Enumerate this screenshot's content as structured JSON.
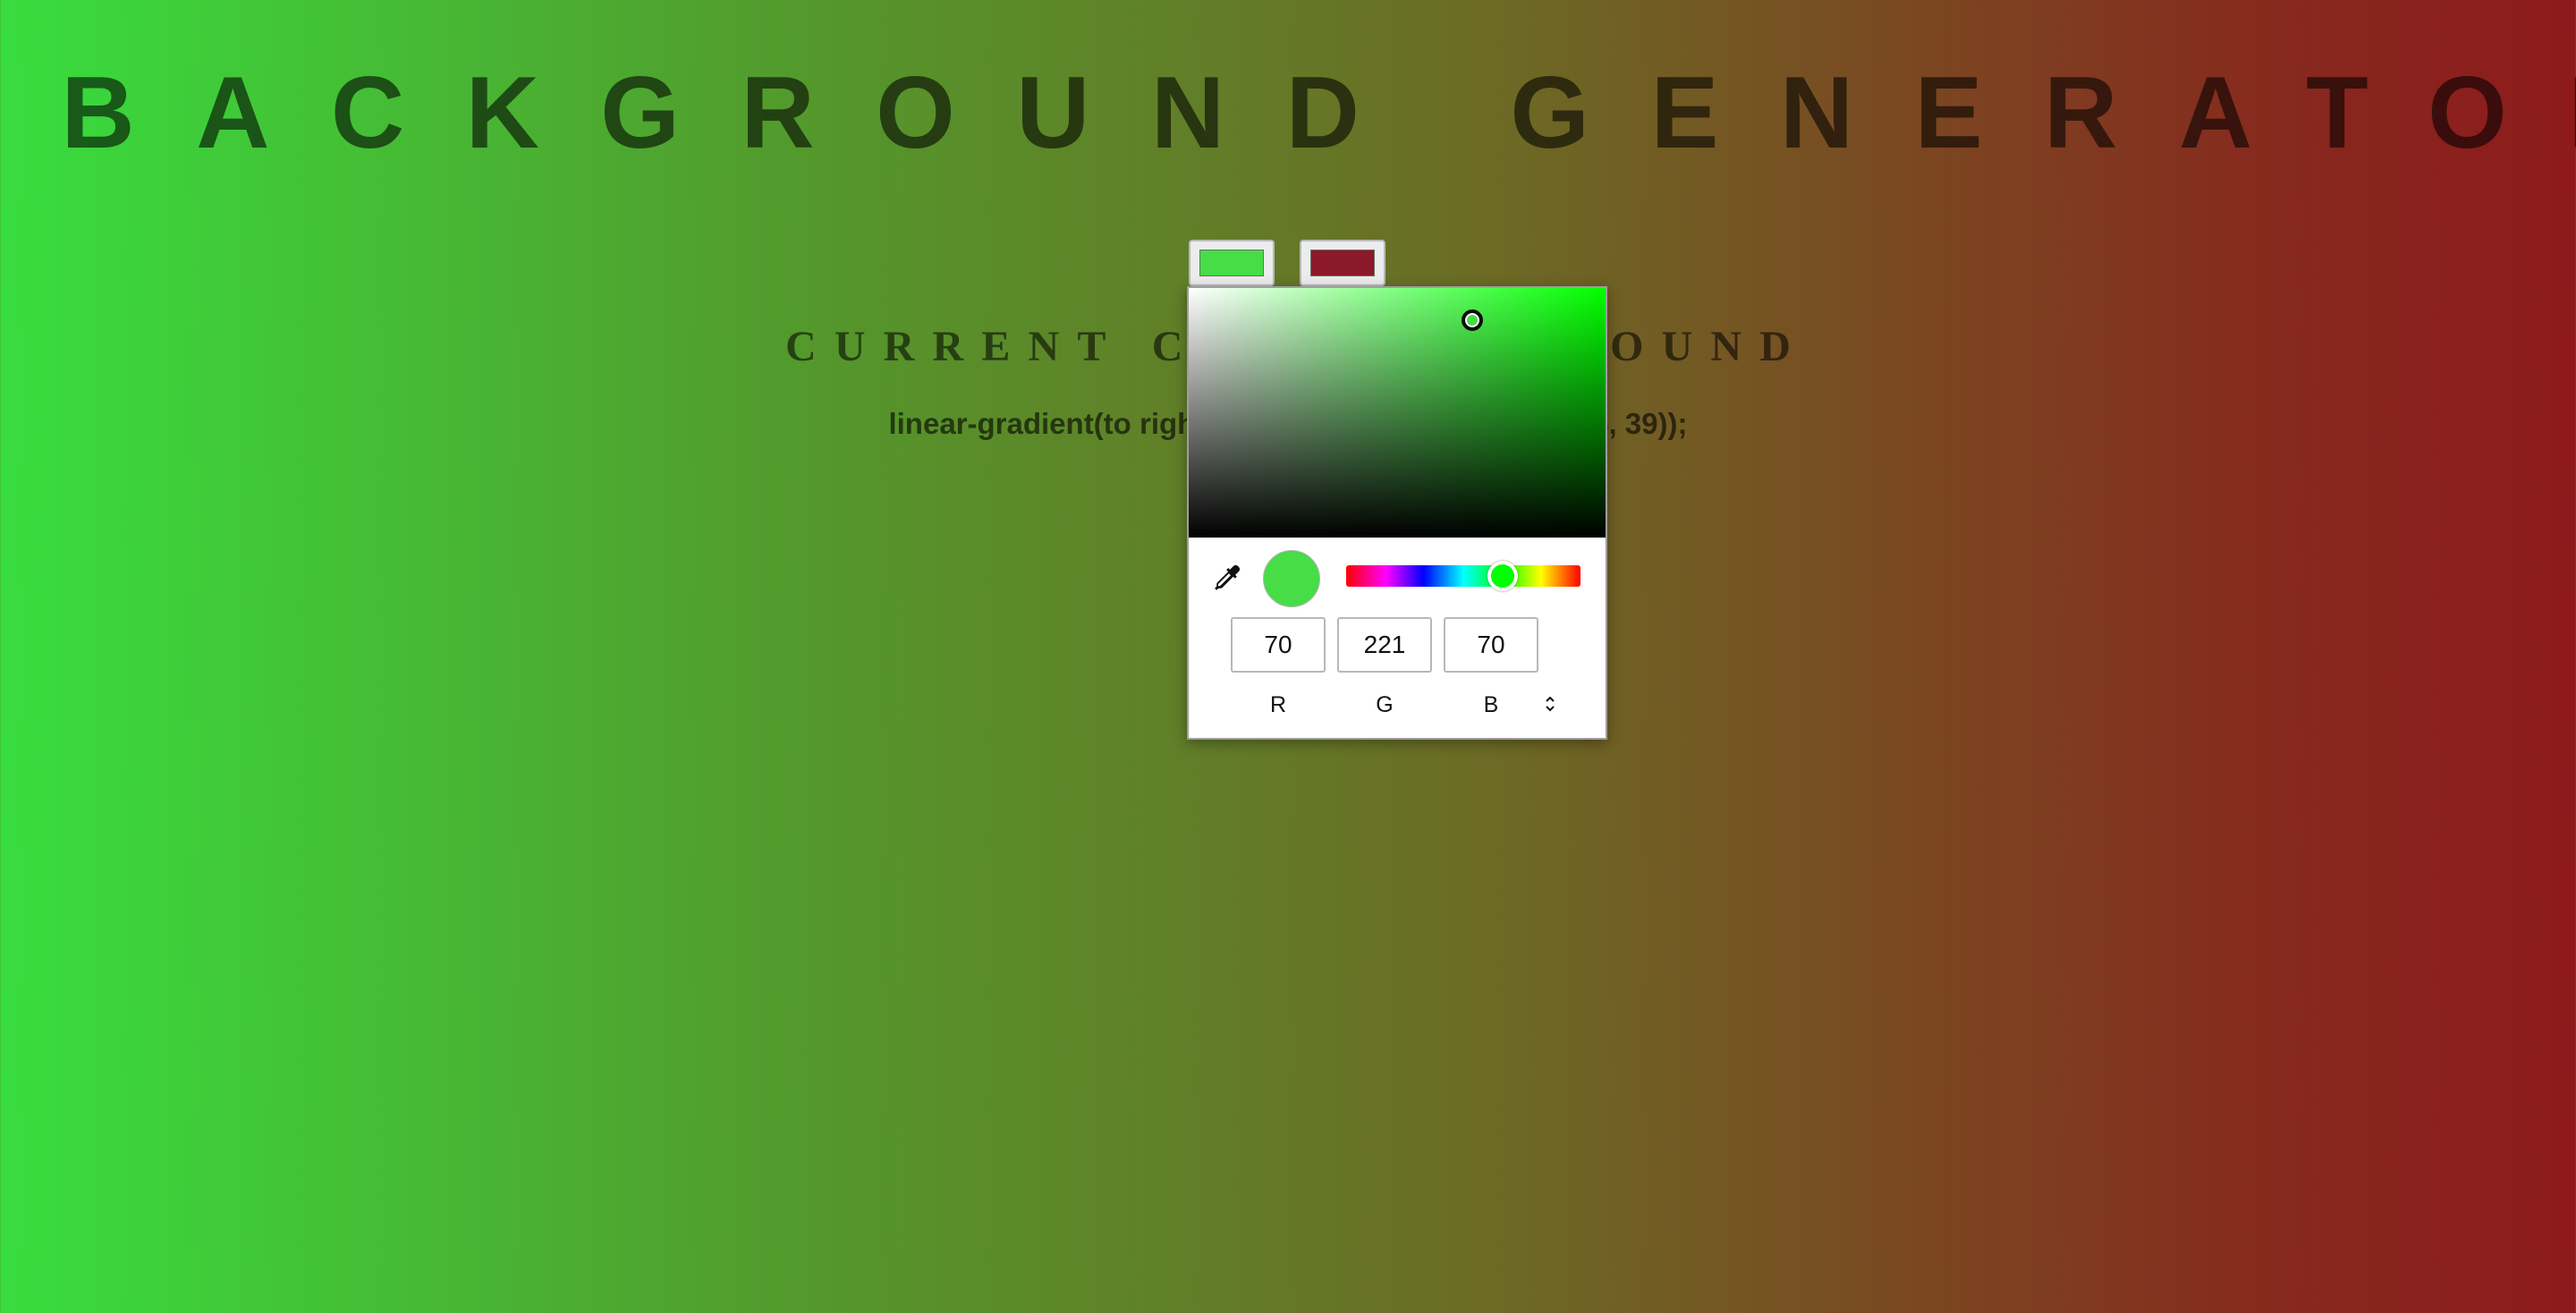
{
  "page": {
    "title": "BACKGROUND GENERATOR",
    "subtitle": "CURRENT CSS BACKGROUND",
    "css_text": "linear-gradient(to right, rgb(70, 221, 70), rgb(140, 25, 39));"
  },
  "color_inputs": [
    {
      "value": "#46dd46"
    },
    {
      "value": "#8c1927"
    }
  ],
  "color_picker": {
    "selected_color": "#46dd46",
    "hue_color": "#00ff00",
    "saturation_fraction": 0.68,
    "value_fraction": 0.87,
    "hue_degrees": 120,
    "icons": [
      "eyedropper-icon",
      "chevron-up-down-icon"
    ],
    "fields": {
      "r": "70",
      "g": "221",
      "b": "70"
    },
    "labels": {
      "r": "R",
      "g": "G",
      "b": "B"
    }
  }
}
